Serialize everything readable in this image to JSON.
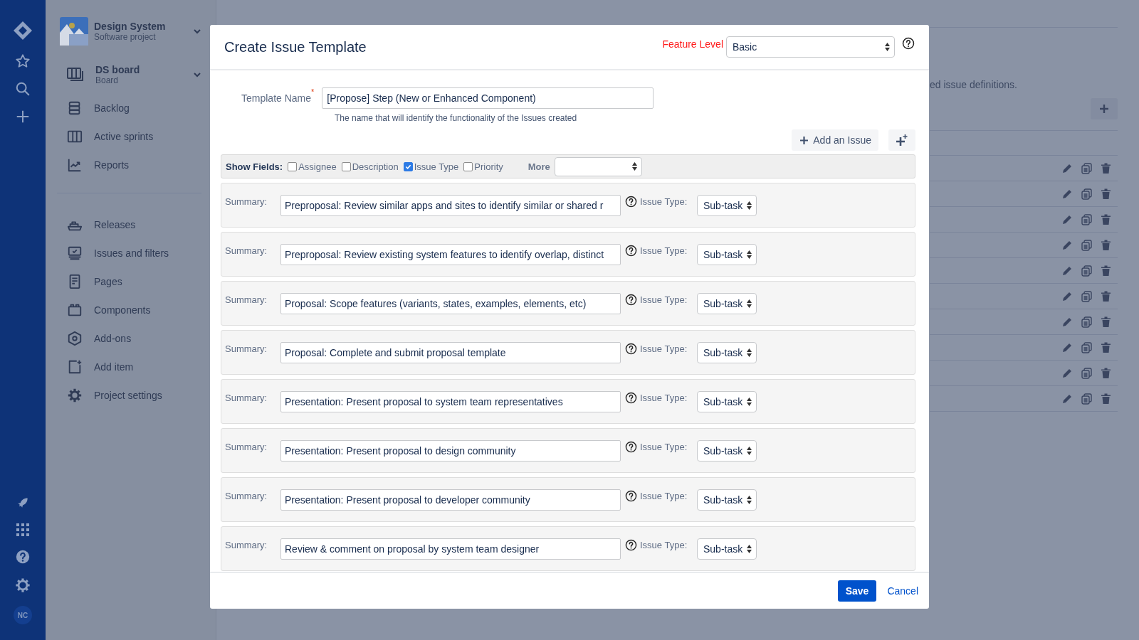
{
  "global_nav": {
    "avatar_initials": "NC"
  },
  "project": {
    "name": "Design System",
    "type": "Software project"
  },
  "board": {
    "name": "DS board",
    "type": "Board"
  },
  "nav_groups": [
    [
      {
        "label": "Backlog",
        "kind": "backlog"
      },
      {
        "label": "Active sprints",
        "kind": "sprints"
      },
      {
        "label": "Reports",
        "kind": "reports"
      }
    ],
    [
      {
        "label": "Releases",
        "kind": "releases"
      },
      {
        "label": "Issues and filters",
        "kind": "issues"
      },
      {
        "label": "Pages",
        "kind": "pages"
      },
      {
        "label": "Components",
        "kind": "components"
      },
      {
        "label": "Add-ons",
        "kind": "addons"
      },
      {
        "label": "Add item",
        "kind": "additem"
      },
      {
        "label": "Project settings",
        "kind": "settings"
      }
    ]
  ],
  "background": {
    "description": "ed issue definitions."
  },
  "dialog": {
    "title": "Create Issue Template",
    "feature_level_label": "Feature Level",
    "feature_level": "Basic",
    "template_name_label": "Template Name",
    "required_mark": "*",
    "template_name": "[Propose] Step (New or Enhanced Component)",
    "template_name_hint": "The name that will identify the functionality of the Issues created",
    "add_issue_button": "Add an Issue",
    "show_fields_label": "Show Fields:",
    "fields": [
      {
        "label": "Assignee",
        "checked": false
      },
      {
        "label": "Description",
        "checked": false
      },
      {
        "label": "Issue Type",
        "checked": true
      },
      {
        "label": "Priority",
        "checked": false
      }
    ],
    "more_label": "More",
    "issues": [
      {
        "summary_label": "Summary:",
        "summary": "Preproposal: Review similar apps and sites to identify similar or shared r",
        "issue_type_label": "Issue Type:",
        "issue_type": "Sub-task"
      },
      {
        "summary_label": "Summary:",
        "summary": "Preproposal: Review existing system features to identify overlap, distinct",
        "issue_type_label": "Issue Type:",
        "issue_type": "Sub-task"
      },
      {
        "summary_label": "Summary:",
        "summary": "Proposal: Scope features (variants, states, examples, elements, etc)",
        "issue_type_label": "Issue Type:",
        "issue_type": "Sub-task"
      },
      {
        "summary_label": "Summary:",
        "summary": "Proposal: Complete and submit proposal template",
        "issue_type_label": "Issue Type:",
        "issue_type": "Sub-task"
      },
      {
        "summary_label": "Summary:",
        "summary": "Presentation: Present proposal to system team representatives",
        "issue_type_label": "Issue Type:",
        "issue_type": "Sub-task"
      },
      {
        "summary_label": "Summary:",
        "summary": "Presentation: Present proposal to design community",
        "issue_type_label": "Issue Type:",
        "issue_type": "Sub-task"
      },
      {
        "summary_label": "Summary:",
        "summary": "Presentation: Present proposal to developer community",
        "issue_type_label": "Issue Type:",
        "issue_type": "Sub-task"
      },
      {
        "summary_label": "Summary:",
        "summary": "Review & comment on proposal by system team designer",
        "issue_type_label": "Issue Type:",
        "issue_type": "Sub-task"
      }
    ],
    "save_button": "Save",
    "cancel_link": "Cancel"
  }
}
